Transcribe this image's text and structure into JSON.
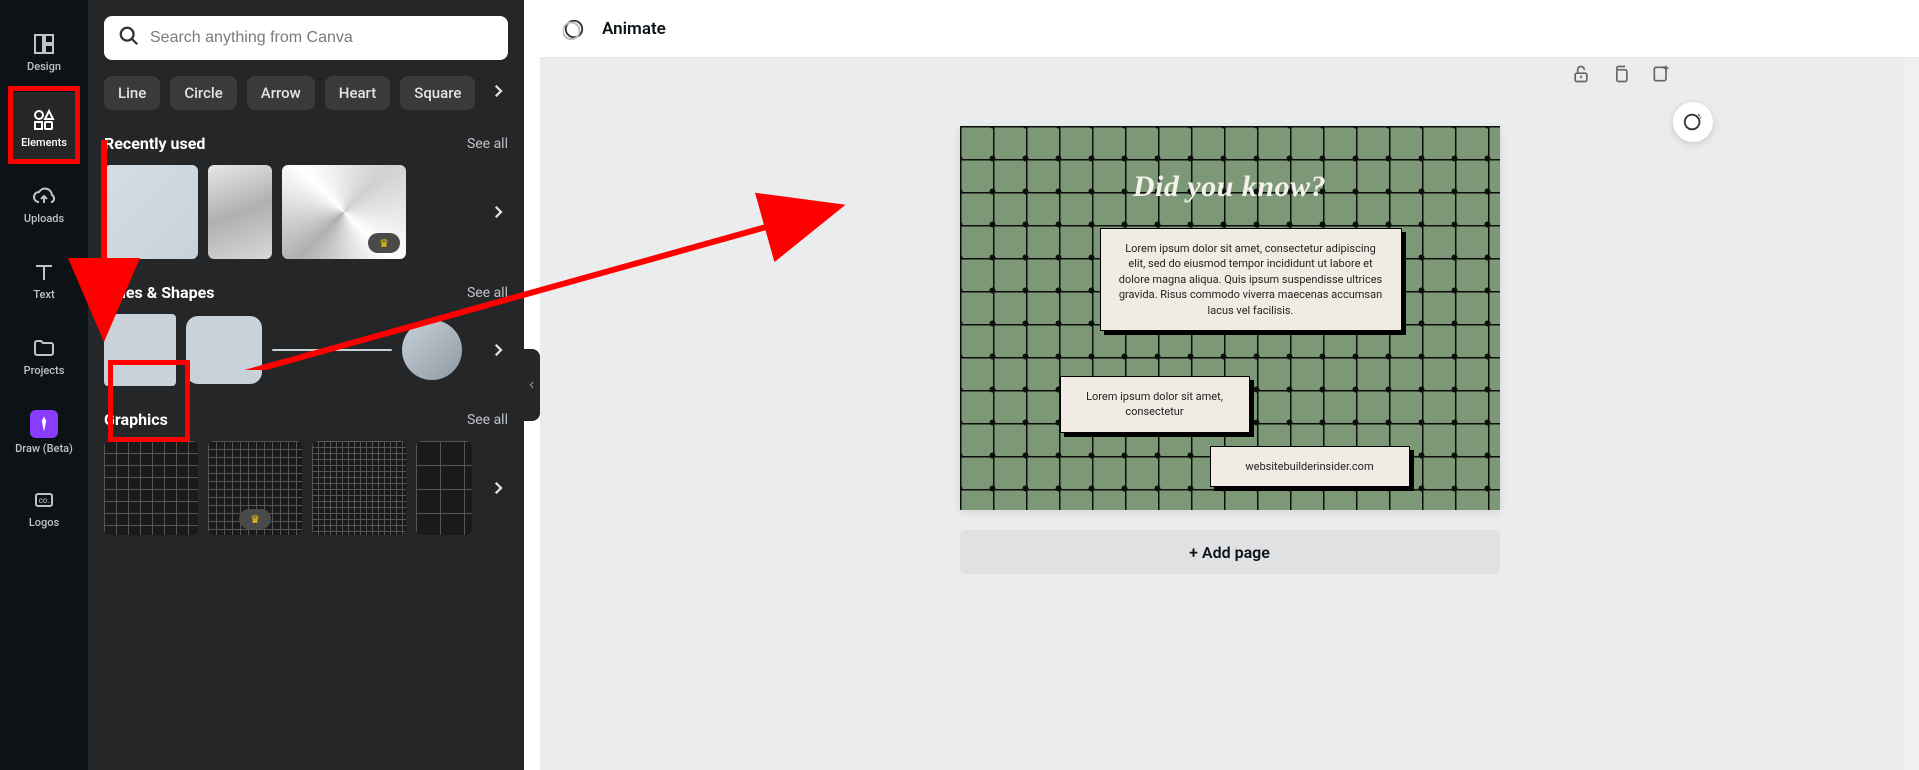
{
  "vbar": {
    "items": [
      {
        "id": "design",
        "label": "Design"
      },
      {
        "id": "elements",
        "label": "Elements"
      },
      {
        "id": "uploads",
        "label": "Uploads"
      },
      {
        "id": "text",
        "label": "Text"
      },
      {
        "id": "projects",
        "label": "Projects"
      },
      {
        "id": "draw",
        "label": "Draw (Beta)"
      },
      {
        "id": "logos",
        "label": "Logos"
      }
    ]
  },
  "search": {
    "placeholder": "Search anything from Canva"
  },
  "chips": [
    "Line",
    "Circle",
    "Arrow",
    "Heart",
    "Square"
  ],
  "sections": {
    "recent": {
      "title": "Recently used",
      "see_all": "See all"
    },
    "shapes": {
      "title": "Lines & Shapes",
      "see_all": "See all"
    },
    "graphics": {
      "title": "Graphics",
      "see_all": "See all"
    }
  },
  "topbar": {
    "animate": "Animate"
  },
  "canvas": {
    "headline": "Did you know?",
    "card1": "Lorem ipsum dolor sit amet, consectetur adipiscing elit, sed do eiusmod tempor incididunt ut labore et dolore magna aliqua. Quis ipsum suspendisse ultrices gravida. Risus commodo viverra maecenas accumsan lacus vel facilisis.",
    "card2": "Lorem ipsum dolor sit amet, consectetur",
    "card3": "websitebuilderinsider.com",
    "add_page": "+ Add page"
  }
}
